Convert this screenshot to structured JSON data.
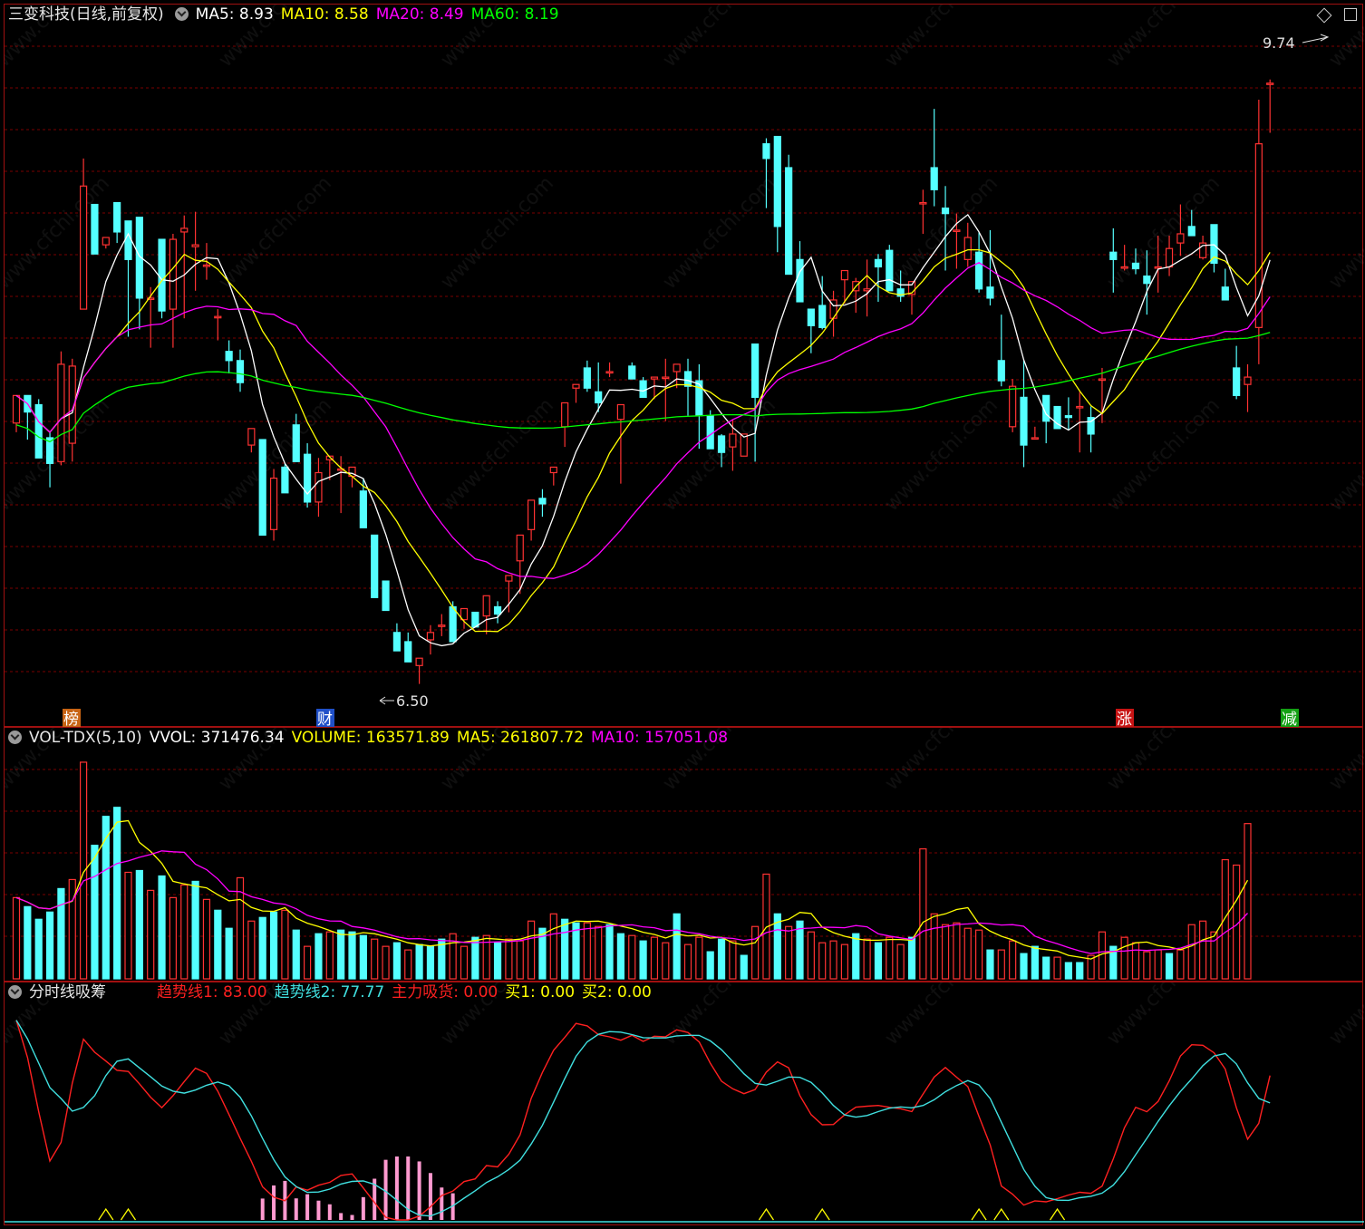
{
  "main_panel": {
    "title": "三变科技(日线,前复权)",
    "ma_labels": [
      {
        "name": "MA5",
        "value": "8.93",
        "color": "#ffffff"
      },
      {
        "name": "MA10",
        "value": "8.58",
        "color": "#ffff00"
      },
      {
        "name": "MA20",
        "value": "8.49",
        "color": "#ff00ff"
      },
      {
        "name": "MA60",
        "value": "8.19",
        "color": "#00ff00"
      }
    ],
    "high_label": "9.74",
    "low_label": "6.50",
    "event_tags": [
      {
        "text": "榜",
        "color": "#c86414"
      },
      {
        "text": "财",
        "color": "#2050c8"
      },
      {
        "text": "涨",
        "color": "#c81414"
      },
      {
        "text": "减",
        "color": "#14a014"
      }
    ]
  },
  "volume_panel": {
    "title": "VOL-TDX(5,10)",
    "labels": [
      {
        "name": "VVOL",
        "value": "371476.34",
        "color": "#ffffff"
      },
      {
        "name": "VOLUME",
        "value": "163571.89",
        "color": "#ffff00"
      },
      {
        "name": "MA5",
        "value": "261807.72",
        "color": "#ffff00"
      },
      {
        "name": "MA10",
        "value": "157051.08",
        "color": "#ff00ff"
      }
    ]
  },
  "indicator_panel": {
    "title": "分时线吸筹",
    "labels": [
      {
        "name": "趋势线1",
        "value": "83.00",
        "color": "#ff2020"
      },
      {
        "name": "趋势线2",
        "value": "77.77",
        "color": "#40e0e0"
      },
      {
        "name": "主力吸货",
        "value": "0.00",
        "color": "#ff2020"
      },
      {
        "name": "买1",
        "value": "0.00",
        "color": "#ffff00"
      },
      {
        "name": "买2",
        "value": "0.00",
        "color": "#ffff00"
      }
    ]
  },
  "watermark": "www.cfchi.com",
  "colors": {
    "up": "#ff3232",
    "down": "#54ffff",
    "grid": "#7a0000",
    "border": "#a01010"
  },
  "chart_data": [
    {
      "type": "candlestick",
      "title": "三变科技(日线,前复权)",
      "ylim": [
        6.3,
        10.0
      ],
      "series": [
        {
          "name": "MA5",
          "color": "#ffffff"
        },
        {
          "name": "MA10",
          "color": "#ffff00"
        },
        {
          "name": "MA20",
          "color": "#ff00ff"
        },
        {
          "name": "MA60",
          "color": "#00ff00"
        }
      ],
      "candles": [
        [
          7.87,
          8.02,
          7.82,
          8.02
        ],
        [
          8.02,
          8.02,
          7.78,
          7.93
        ],
        [
          7.97,
          8.0,
          7.68,
          7.68
        ],
        [
          7.79,
          7.82,
          7.52,
          7.65
        ],
        [
          7.66,
          8.26,
          7.64,
          8.19
        ],
        [
          7.76,
          8.22,
          7.66,
          8.18
        ],
        [
          8.49,
          9.31,
          8.49,
          9.16
        ],
        [
          9.06,
          9.04,
          8.79,
          8.79
        ],
        [
          8.84,
          8.84,
          8.82,
          8.88
        ],
        [
          9.07,
          9.07,
          8.85,
          8.91
        ],
        [
          8.97,
          8.89,
          8.34,
          8.76
        ],
        [
          8.99,
          8.98,
          8.38,
          8.55
        ],
        [
          8.55,
          8.61,
          8.28,
          8.55
        ],
        [
          8.87,
          8.87,
          8.44,
          8.48
        ],
        [
          8.49,
          8.9,
          8.28,
          8.87
        ],
        [
          8.91,
          9.0,
          8.44,
          8.93
        ],
        [
          8.83,
          9.02,
          8.59,
          8.84
        ],
        [
          8.73,
          8.85,
          8.65,
          8.73
        ],
        [
          8.45,
          8.49,
          8.32,
          8.45
        ],
        [
          8.26,
          8.32,
          8.14,
          8.21
        ],
        [
          8.21,
          8.27,
          8.04,
          8.09
        ],
        [
          7.75,
          7.84,
          7.71,
          7.84
        ],
        [
          7.78,
          7.67,
          7.26,
          7.26
        ],
        [
          7.29,
          7.62,
          7.23,
          7.57
        ],
        [
          7.63,
          7.65,
          7.49,
          7.49
        ],
        [
          7.86,
          7.92,
          7.66,
          7.66
        ],
        [
          7.7,
          7.76,
          7.41,
          7.44
        ],
        [
          7.44,
          7.68,
          7.36,
          7.6
        ],
        [
          7.67,
          7.69,
          7.56,
          7.69
        ],
        [
          7.62,
          7.69,
          7.38,
          7.62
        ],
        [
          7.58,
          7.63,
          7.52,
          7.63
        ],
        [
          7.5,
          7.57,
          7.3,
          7.3
        ],
        [
          7.26,
          7.21,
          6.92,
          6.92
        ],
        [
          7.01,
          7.01,
          6.85,
          6.85
        ],
        [
          6.73,
          6.78,
          6.63,
          6.63
        ],
        [
          6.68,
          6.73,
          6.57,
          6.57
        ],
        [
          6.55,
          6.59,
          6.45,
          6.59
        ],
        [
          6.69,
          6.77,
          6.61,
          6.73
        ],
        [
          6.77,
          6.83,
          6.71,
          6.77
        ],
        [
          6.87,
          6.9,
          6.68,
          6.68
        ],
        [
          6.8,
          6.86,
          6.75,
          6.86
        ],
        [
          6.84,
          6.84,
          6.76,
          6.76
        ],
        [
          6.82,
          6.93,
          6.72,
          6.93
        ],
        [
          6.87,
          6.9,
          6.78,
          6.83
        ],
        [
          7.01,
          7.04,
          6.84,
          7.04
        ],
        [
          7.12,
          7.26,
          6.94,
          7.26
        ],
        [
          7.29,
          7.45,
          7.23,
          7.45
        ],
        [
          7.46,
          7.51,
          7.36,
          7.43
        ],
        [
          7.6,
          7.63,
          7.53,
          7.63
        ],
        [
          7.85,
          7.98,
          7.74,
          7.98
        ],
        [
          8.06,
          8.08,
          7.98,
          8.08
        ],
        [
          8.17,
          8.21,
          8.04,
          8.06
        ],
        [
          8.04,
          8.2,
          7.93,
          7.98
        ],
        [
          8.15,
          8.2,
          8.12,
          8.15
        ],
        [
          7.89,
          7.97,
          7.54,
          7.97
        ],
        [
          8.18,
          8.2,
          8.11,
          8.11
        ],
        [
          8.1,
          8.12,
          8.01,
          8.01
        ],
        [
          8.11,
          8.12,
          8.0,
          8.12
        ],
        [
          8.12,
          8.22,
          7.88,
          8.12
        ],
        [
          8.15,
          8.19,
          8.06,
          8.19
        ],
        [
          8.15,
          8.22,
          7.91,
          8.07
        ],
        [
          8.1,
          8.19,
          7.73,
          7.91
        ],
        [
          7.91,
          7.94,
          7.73,
          7.73
        ],
        [
          7.8,
          7.81,
          7.63,
          7.71
        ],
        [
          7.74,
          7.89,
          7.61,
          7.81
        ],
        [
          7.69,
          7.81,
          7.73,
          7.81
        ],
        [
          8.3,
          8.3,
          7.66,
          8.01
        ],
        [
          9.39,
          9.42,
          9.04,
          9.31
        ],
        [
          9.43,
          9.43,
          8.8,
          8.94
        ],
        [
          9.26,
          9.33,
          8.68,
          8.68
        ],
        [
          8.76,
          8.86,
          8.53,
          8.53
        ],
        [
          8.49,
          8.49,
          8.25,
          8.4
        ],
        [
          8.51,
          8.67,
          8.38,
          8.39
        ],
        [
          8.44,
          8.59,
          8.34,
          8.54
        ],
        [
          8.65,
          8.7,
          8.52,
          8.7
        ],
        [
          8.59,
          8.66,
          8.47,
          8.64
        ],
        [
          8.59,
          8.76,
          8.45,
          8.6
        ],
        [
          8.76,
          8.79,
          8.53,
          8.72
        ],
        [
          8.81,
          8.84,
          8.59,
          8.59
        ],
        [
          8.6,
          8.7,
          8.53,
          8.56
        ],
        [
          8.57,
          8.64,
          8.46,
          8.64
        ],
        [
          9.07,
          9.14,
          8.9,
          9.07
        ],
        [
          9.26,
          9.58,
          9.05,
          9.14
        ],
        [
          9.04,
          9.16,
          8.7,
          9.01
        ],
        [
          8.92,
          9.01,
          8.71,
          8.92
        ],
        [
          8.76,
          8.96,
          8.72,
          8.88
        ],
        [
          8.8,
          8.91,
          8.58,
          8.6
        ],
        [
          8.61,
          8.92,
          8.51,
          8.55
        ],
        [
          8.21,
          8.46,
          8.07,
          8.1
        ],
        [
          7.85,
          8.11,
          7.82,
          8.07
        ],
        [
          8.01,
          8.21,
          7.63,
          7.75
        ],
        [
          7.79,
          7.85,
          7.79,
          7.79
        ],
        [
          8.02,
          8.02,
          7.76,
          7.88
        ],
        [
          7.96,
          7.96,
          7.84,
          7.84
        ],
        [
          7.91,
          8.01,
          7.83,
          7.9
        ],
        [
          7.96,
          8.04,
          7.71,
          7.96
        ],
        [
          7.9,
          7.96,
          7.71,
          7.81
        ],
        [
          8.11,
          8.17,
          7.87,
          8.11
        ],
        [
          8.8,
          8.93,
          8.58,
          8.76
        ],
        [
          8.72,
          8.84,
          8.7,
          8.72
        ],
        [
          8.74,
          8.82,
          8.68,
          8.71
        ],
        [
          8.67,
          8.81,
          8.46,
          8.63
        ],
        [
          8.72,
          8.89,
          8.58,
          8.72
        ],
        [
          8.72,
          8.89,
          8.67,
          8.82
        ],
        [
          8.85,
          9.06,
          8.78,
          8.9
        ],
        [
          8.94,
          9.03,
          8.89,
          8.89
        ],
        [
          8.77,
          8.89,
          8.76,
          8.85
        ],
        [
          8.95,
          8.95,
          8.69,
          8.74
        ],
        [
          8.61,
          8.71,
          8.54,
          8.54
        ],
        [
          8.17,
          8.29,
          8.0,
          8.02
        ],
        [
          8.08,
          8.19,
          7.93,
          8.12
        ],
        [
          8.39,
          9.63,
          8.19,
          9.39
        ],
        [
          9.72,
          9.74,
          9.45,
          9.72
        ]
      ]
    },
    {
      "type": "bar",
      "title": "VOL-TDX(5,10)",
      "series": [
        {
          "name": "VOLUME",
          "color": "#ffff00"
        },
        {
          "name": "MA5",
          "color": "#ffff00"
        },
        {
          "name": "MA10",
          "color": "#ff00ff"
        }
      ],
      "values": [
        [
          45000,
          1
        ],
        [
          40000,
          0
        ],
        [
          33000,
          0
        ],
        [
          37000,
          0
        ],
        [
          50000,
          0
        ],
        [
          55000,
          1
        ],
        [
          120000,
          1
        ],
        [
          74000,
          0
        ],
        [
          90000,
          0
        ],
        [
          95000,
          0
        ],
        [
          59000,
          1
        ],
        [
          60000,
          0
        ],
        [
          49000,
          1
        ],
        [
          57000,
          0
        ],
        [
          45000,
          1
        ],
        [
          52000,
          1
        ],
        [
          54000,
          0
        ],
        [
          44000,
          1
        ],
        [
          38000,
          0
        ],
        [
          28000,
          0
        ],
        [
          56000,
          1
        ],
        [
          32000,
          1
        ],
        [
          34000,
          0
        ],
        [
          37000,
          0
        ],
        [
          38000,
          1
        ],
        [
          27000,
          0
        ],
        [
          18000,
          1
        ],
        [
          25000,
          0
        ],
        [
          26000,
          1
        ],
        [
          27000,
          0
        ],
        [
          26000,
          0
        ],
        [
          24000,
          0
        ],
        [
          22000,
          1
        ],
        [
          18000,
          1
        ],
        [
          20000,
          0
        ],
        [
          16000,
          1
        ],
        [
          19000,
          0
        ],
        [
          18000,
          0
        ],
        [
          22000,
          0
        ],
        [
          25000,
          1
        ],
        [
          18000,
          1
        ],
        [
          23000,
          0
        ],
        [
          24000,
          1
        ],
        [
          20000,
          0
        ],
        [
          22000,
          1
        ],
        [
          21000,
          1
        ],
        [
          32000,
          1
        ],
        [
          28000,
          0
        ],
        [
          36000,
          1
        ],
        [
          33000,
          0
        ],
        [
          31000,
          0
        ],
        [
          31000,
          1
        ],
        [
          29000,
          1
        ],
        [
          30000,
          0
        ],
        [
          25000,
          0
        ],
        [
          24000,
          1
        ],
        [
          21000,
          0
        ],
        [
          23000,
          1
        ],
        [
          20000,
          1
        ],
        [
          36000,
          0
        ],
        [
          19000,
          1
        ],
        [
          23000,
          1
        ],
        [
          15000,
          0
        ],
        [
          22000,
          0
        ],
        [
          21000,
          1
        ],
        [
          13000,
          0
        ],
        [
          29000,
          1
        ],
        [
          58000,
          1
        ],
        [
          36000,
          0
        ],
        [
          29000,
          1
        ],
        [
          32000,
          0
        ],
        [
          26000,
          1
        ],
        [
          20000,
          1
        ],
        [
          21000,
          1
        ],
        [
          19000,
          1
        ],
        [
          25000,
          0
        ],
        [
          22000,
          1
        ],
        [
          20000,
          0
        ],
        [
          23000,
          1
        ],
        [
          19000,
          1
        ],
        [
          23000,
          0
        ],
        [
          72000,
          1
        ],
        [
          36000,
          1
        ],
        [
          30000,
          1
        ],
        [
          31000,
          1
        ],
        [
          28000,
          1
        ],
        [
          27000,
          1
        ],
        [
          16000,
          0
        ],
        [
          16000,
          1
        ],
        [
          21000,
          1
        ],
        [
          14000,
          0
        ],
        [
          18000,
          0
        ],
        [
          12000,
          0
        ],
        [
          12000,
          1
        ],
        [
          9000,
          0
        ],
        [
          9000,
          0
        ],
        [
          13000,
          1
        ],
        [
          26000,
          1
        ],
        [
          18000,
          0
        ],
        [
          23000,
          1
        ],
        [
          20000,
          1
        ],
        [
          15000,
          1
        ],
        [
          16000,
          1
        ],
        [
          14000,
          0
        ],
        [
          16000,
          1
        ],
        [
          30000,
          1
        ],
        [
          32000,
          1
        ],
        [
          26000,
          1
        ],
        [
          66000,
          1
        ],
        [
          63000,
          1
        ],
        [
          86000,
          1
        ]
      ]
    },
    {
      "type": "line",
      "title": "分时线吸筹",
      "ylim": [
        0,
        100
      ],
      "series": [
        {
          "name": "趋势线1",
          "color": "#ff2020"
        },
        {
          "name": "趋势线2",
          "color": "#40e0e0"
        }
      ]
    }
  ]
}
